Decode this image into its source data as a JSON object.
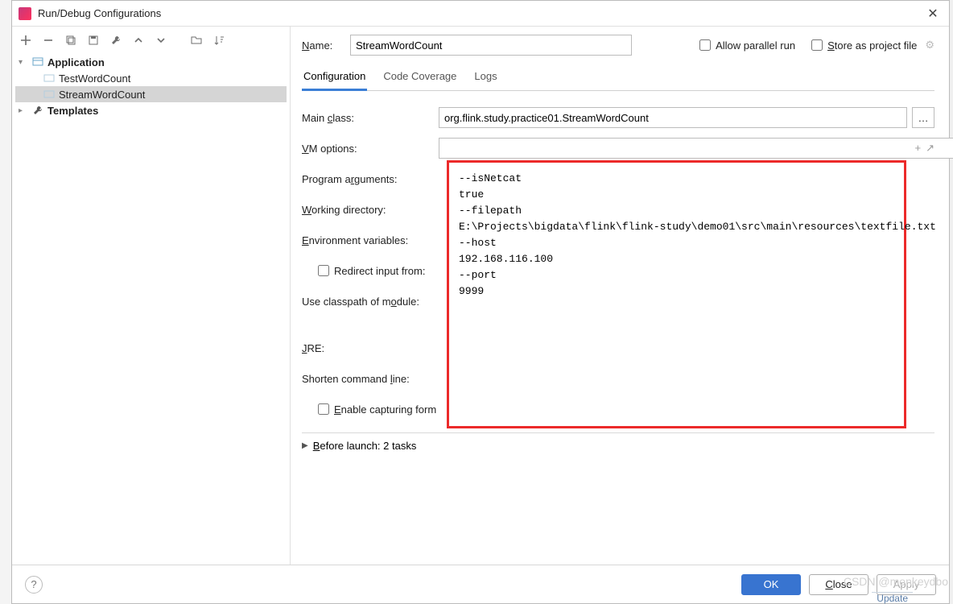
{
  "window": {
    "title": "Run/Debug Configurations"
  },
  "toolbar_icons": [
    "add",
    "remove",
    "copy",
    "save",
    "wrench",
    "up",
    "down",
    "folder",
    "sort"
  ],
  "tree": {
    "application_label": "Application",
    "items": [
      "TestWordCount",
      "StreamWordCount"
    ],
    "templates_label": "Templates"
  },
  "form": {
    "name_label": "Name:",
    "name_value": "StreamWordCount",
    "allow_parallel_label": "Allow parallel run",
    "store_project_label": "Store as project file",
    "tabs": {
      "configuration": "Configuration",
      "code_coverage": "Code Coverage",
      "logs": "Logs"
    },
    "main_class_label": "Main class:",
    "main_class_value": "org.flink.study.practice01.StreamWordCount",
    "vm_options_label": "VM options:",
    "program_args_label": "Program arguments:",
    "working_dir_label": "Working directory:",
    "env_vars_label": "Environment variables:",
    "redirect_label": "Redirect input from:",
    "classpath_label": "Use classpath of module:",
    "jre_label": "JRE:",
    "shorten_label": "Shorten command line:",
    "enable_capture_label": "Enable capturing form",
    "before_launch_label": "Before launch: 2 tasks"
  },
  "program_args_text": "--isNetcat\ntrue\n--filepath\nE:\\Projects\\bigdata\\flink\\flink-study\\demo01\\src\\main\\resources\\textfile.txt\n--host\n192.168.116.100\n--port\n9999",
  "footer": {
    "ok": "OK",
    "close": "Close",
    "apply": "Apply"
  },
  "watermark": "CSDN @monkeydbo",
  "update": "Update"
}
